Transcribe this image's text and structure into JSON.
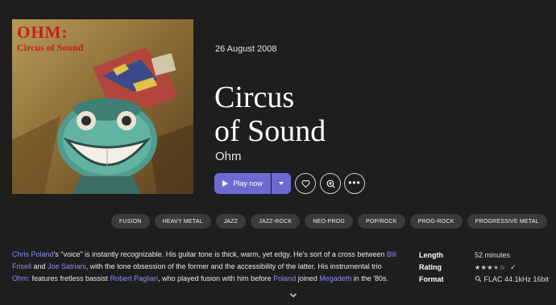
{
  "album": {
    "release_date": "26 August 2008",
    "title_line1": "Circus",
    "title_line2": "of Sound",
    "artist": "Ohm",
    "cover": {
      "band_text": "OHM:",
      "title_text": "Circus of Sound"
    }
  },
  "actions": {
    "play_label": "Play now"
  },
  "tags": [
    "FUSION",
    "HEAVY METAL",
    "JAZZ",
    "JAZZ-ROCK",
    "NEO-PROG",
    "POP/ROCK",
    "PROG-ROCK",
    "PROGRESSIVE METAL"
  ],
  "description": {
    "segments": [
      {
        "text": "Chris Poland",
        "link": true
      },
      {
        "text": "'s \"voice\" is instantly recognizable. His guitar tone is thick, warm, yet edgy. He's sort of a cross between ",
        "link": false
      },
      {
        "text": "Bill Frisell",
        "link": true
      },
      {
        "text": " and ",
        "link": false
      },
      {
        "text": "Joe Satriani",
        "link": true
      },
      {
        "text": ", with the tone obsession of the former and the accessibility of the latter. His instrumental trio ",
        "link": false
      },
      {
        "text": "Ohm:",
        "link": true
      },
      {
        "text": " features fretless bassist ",
        "link": false
      },
      {
        "text": "Robert Pagliari",
        "link": true
      },
      {
        "text": ", who played fusion with him before ",
        "link": false
      },
      {
        "text": "Poland",
        "link": true
      },
      {
        "text": " joined ",
        "link": false
      },
      {
        "text": "Megadeth",
        "link": true
      },
      {
        "text": "  in the '80s.",
        "link": false
      }
    ]
  },
  "info": {
    "length_label": "Length",
    "length_value": "52 minutes",
    "rating_label": "Rating",
    "rating_value": 3.5,
    "rating_max": 5,
    "format_label": "Format",
    "format_value": "FLAC 44.1kHz 16bit"
  },
  "icons": {
    "heart": "heart-icon",
    "add": "add-to-playlist-icon",
    "more": "more-icon",
    "check": "check-icon",
    "format": "quality-search-icon",
    "expand": "chevron-down-icon"
  },
  "colors": {
    "background": "#1e1e1e",
    "accent": "#6c6bd1",
    "link": "#8b8ff0",
    "tag_bg": "#3a3a3a"
  }
}
